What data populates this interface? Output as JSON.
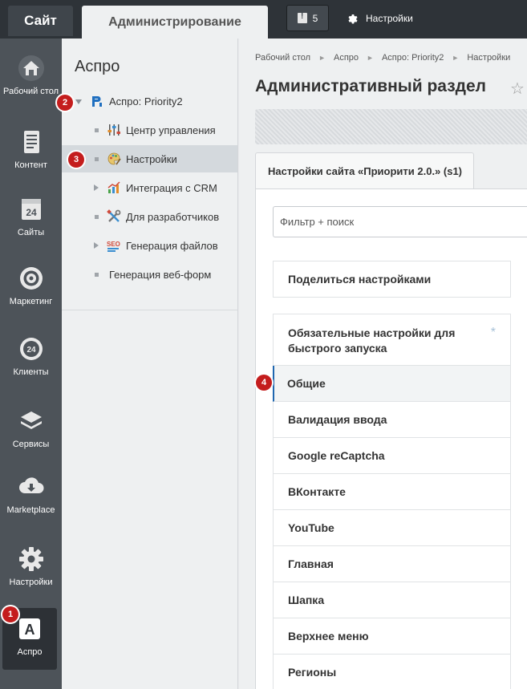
{
  "topbar": {
    "site_tab": "Сайт",
    "admin_tab": "Администрирование",
    "notifications_count": "5",
    "settings_label": "Настройки"
  },
  "sidebar": {
    "items": [
      {
        "label": "Рабочий стол",
        "icon": "home-icon"
      },
      {
        "label": "Контент",
        "icon": "document-icon"
      },
      {
        "label": "Сайты",
        "icon": "calendar-24-icon"
      },
      {
        "label": "Маркетинг",
        "icon": "target-icon"
      },
      {
        "label": "Клиенты",
        "icon": "clients-24-icon"
      },
      {
        "label": "Сервисы",
        "icon": "layers-icon"
      },
      {
        "label": "Marketplace",
        "icon": "cloud-download-icon"
      },
      {
        "label": "Настройки",
        "icon": "gear-icon"
      },
      {
        "label": "Аспро",
        "icon": "aspro-a-icon"
      }
    ]
  },
  "tree": {
    "title": "Аспро",
    "items": [
      {
        "label": "Аспро: Priority2",
        "icon": "priority-logo-icon"
      },
      {
        "label": "Центр управления",
        "icon": "sliders-icon"
      },
      {
        "label": "Настройки",
        "icon": "palette-icon"
      },
      {
        "label": "Интеграция с CRM",
        "icon": "chart-icon"
      },
      {
        "label": "Для разработчиков",
        "icon": "tools-icon"
      },
      {
        "label": "Генерация файлов",
        "icon": "seo-icon"
      },
      {
        "label": "Генерация веб-форм",
        "icon": ""
      }
    ]
  },
  "main": {
    "breadcrumb": [
      "Рабочий стол",
      "Аспро",
      "Аспро: Priority2",
      "Настройки"
    ],
    "title": "Административный раздел",
    "tab_label": "Настройки сайта «Приорити 2.0.» (s1)",
    "filter_placeholder": "Фильтр + поиск",
    "share_settings": "Поделиться настройками",
    "menu": [
      "Обязательные настройки для быстрого запуска",
      "Общие",
      "Валидация ввода",
      "Google reCaptcha",
      "ВКонтакте",
      "YouTube",
      "Главная",
      "Шапка",
      "Верхнее меню",
      "Регионы"
    ]
  },
  "badges": [
    "1",
    "2",
    "3",
    "4"
  ],
  "colors": {
    "topbar": "#2e3338",
    "sidebar": "#4d5359",
    "panel": "#eef0f1",
    "badge": "#c41d1d",
    "active_marker": "#2067b0"
  }
}
